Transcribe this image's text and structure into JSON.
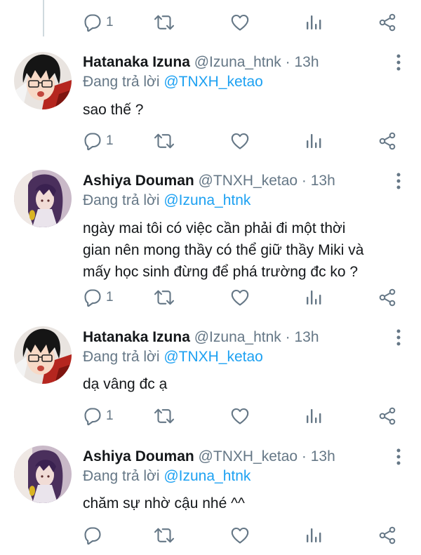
{
  "tweets": [
    {
      "actions": {
        "reply_count": "1"
      }
    },
    {
      "display_name": "Hatanaka Izuna",
      "handle_time": "@Izuna_htnk · 13h",
      "replying_prefix": "Đang trả lời ",
      "replying_to": "@TNXH_ketao",
      "text": "sao thế ?",
      "actions": {
        "reply_count": "1"
      }
    },
    {
      "display_name": "Ashiya Douman",
      "handle_time": "@TNXH_ketao · 13h",
      "replying_prefix": "Đang trả lời ",
      "replying_to": "@Izuna_htnk",
      "text_lines": [
        "ngày mai tôi có việc cần phải đi một thời",
        "gian nên mong thầy có thể giữ thầy Miki và",
        "mấy học sinh đừng để phá trường đc ko ?"
      ],
      "actions": {
        "reply_count": "1"
      }
    },
    {
      "display_name": "Hatanaka Izuna",
      "handle_time": "@Izuna_htnk · 13h",
      "replying_prefix": "Đang trả lời ",
      "replying_to": "@TNXH_ketao",
      "text": "dạ vâng đc ạ",
      "actions": {
        "reply_count": "1"
      }
    },
    {
      "display_name": "Ashiya Douman",
      "handle_time": "@TNXH_ketao · 13h",
      "replying_prefix": "Đang trả lời ",
      "replying_to": "@Izuna_htnk",
      "text": "chăm sự nhờ cậu nhé ^^",
      "actions": {
        "reply_count": ""
      }
    }
  ],
  "icons": {
    "reply": "reply-icon",
    "retweet": "retweet-icon",
    "like": "heart-icon",
    "stats": "analytics-icon",
    "share": "share-icon",
    "more": "more-vertical-icon"
  },
  "colors": {
    "text": "#14171a",
    "secondary": "#657786",
    "link": "#1da1f2",
    "thread_line": "#cfd9de"
  }
}
